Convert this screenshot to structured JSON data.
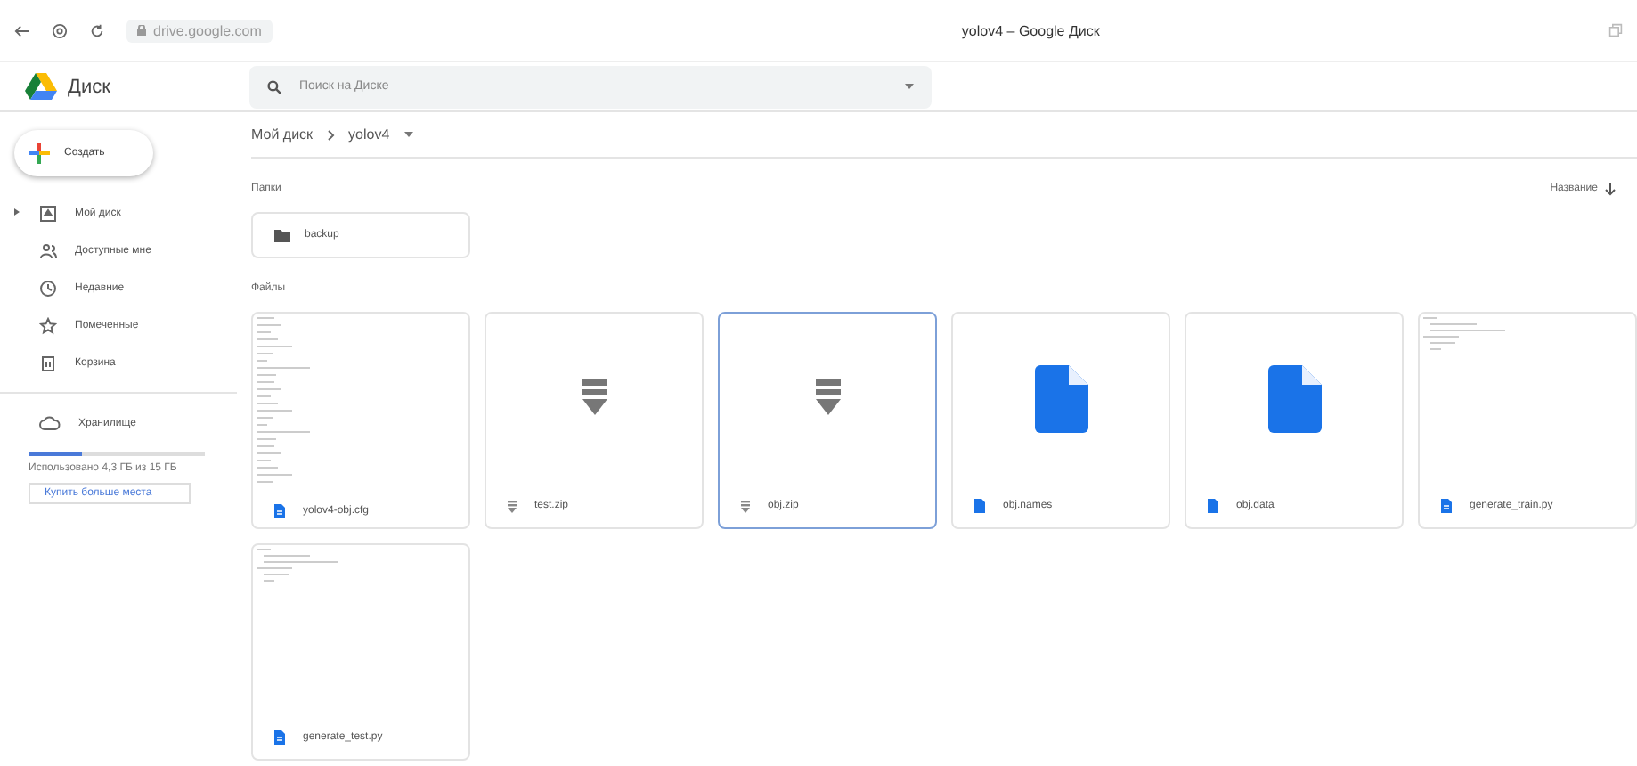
{
  "browser": {
    "url": "drive.google.com",
    "tab_title": "yolov4 – Google Диск"
  },
  "app": {
    "name": "Диск",
    "search": {
      "placeholder": "Поиск на Диске"
    }
  },
  "sidebar": {
    "create_button": "Создать",
    "items": [
      {
        "label": "Мой диск",
        "kind": "drive",
        "expandable": true,
        "selected": false
      },
      {
        "label": "Доступные мне",
        "kind": "shared",
        "expandable": false,
        "selected": false
      },
      {
        "label": "Недавние",
        "kind": "recent",
        "expandable": false,
        "selected": false
      },
      {
        "label": "Помеченные",
        "kind": "star",
        "expandable": false,
        "selected": false
      },
      {
        "label": "Корзина",
        "kind": "trash",
        "expandable": false,
        "selected": false
      }
    ],
    "storage": {
      "label": "Хранилище",
      "level": 0.3,
      "usage": "Использовано 4,3 ГБ из 15 ГБ",
      "buy_button": "Купить больше места"
    }
  },
  "breadcrumb": [
    "Мой диск",
    "yolov4"
  ],
  "folders_heading": "Папки",
  "sort_label": "Название",
  "folders": [
    {
      "name": "backup"
    }
  ],
  "files_heading": "Файлы",
  "files": [
    {
      "name": "yolov4-obj.cfg",
      "kind": "text",
      "selected": false
    },
    {
      "name": "test.zip",
      "kind": "zip",
      "selected": false
    },
    {
      "name": "obj.zip",
      "kind": "zip",
      "selected": true
    },
    {
      "name": "obj.names",
      "kind": "doc",
      "selected": false
    },
    {
      "name": "obj.data",
      "kind": "doc",
      "selected": false
    },
    {
      "name": "generate_train.py",
      "kind": "code",
      "selected": false
    },
    {
      "name": "generate_test.py",
      "kind": "code",
      "selected": false
    }
  ]
}
